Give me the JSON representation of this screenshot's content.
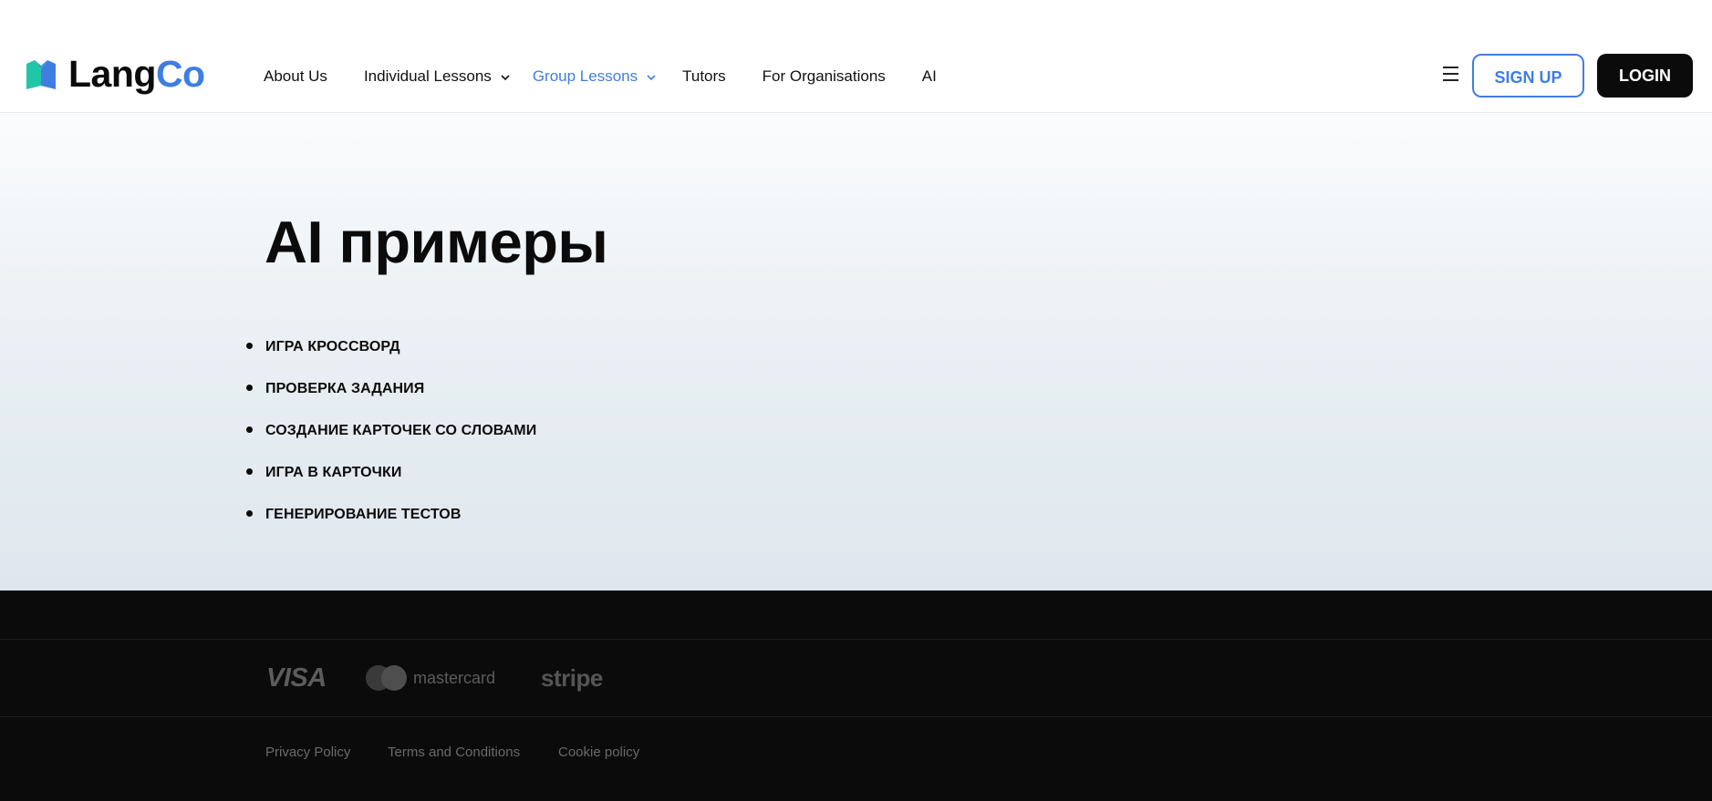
{
  "header": {
    "logo": {
      "lang": "Lang",
      "co": "Co"
    },
    "nav": [
      {
        "label": "About Us"
      },
      {
        "label": "Individual Lessons",
        "has_dropdown": true
      },
      {
        "label": "Group Lessons",
        "has_dropdown": true,
        "active": true
      },
      {
        "label": "Tutors"
      },
      {
        "label": "For Organisations"
      },
      {
        "label": "AI"
      }
    ],
    "signup_label": "SIGN UP",
    "login_label": "LOGIN"
  },
  "hero": {
    "title": "AI примеры",
    "items": [
      "ИГРА КРОССВОРД",
      "ПРОВЕРКА ЗАДАНИЯ",
      "СОЗДАНИЕ КАРТОЧЕК СО СЛОВАМИ",
      "ИГРА В КАРТОЧКИ",
      "ГЕНЕРИРОВАНИЕ ТЕСТОВ"
    ]
  },
  "footer": {
    "payments": {
      "visa": "VISA",
      "mastercard": "mastercard",
      "stripe": "stripe"
    },
    "legal": {
      "privacy": "Privacy Policy",
      "terms": "Terms and Conditions",
      "cookie": "Cookie policy"
    }
  },
  "colors": {
    "accent": "#3f7ee0",
    "dark": "#0b0b0b",
    "footer_text": "#6a6a6a"
  },
  "icons": {
    "logo": "langco-logo-icon",
    "dropdown": "chevron-down-icon",
    "menu": "hamburger-menu-icon"
  }
}
